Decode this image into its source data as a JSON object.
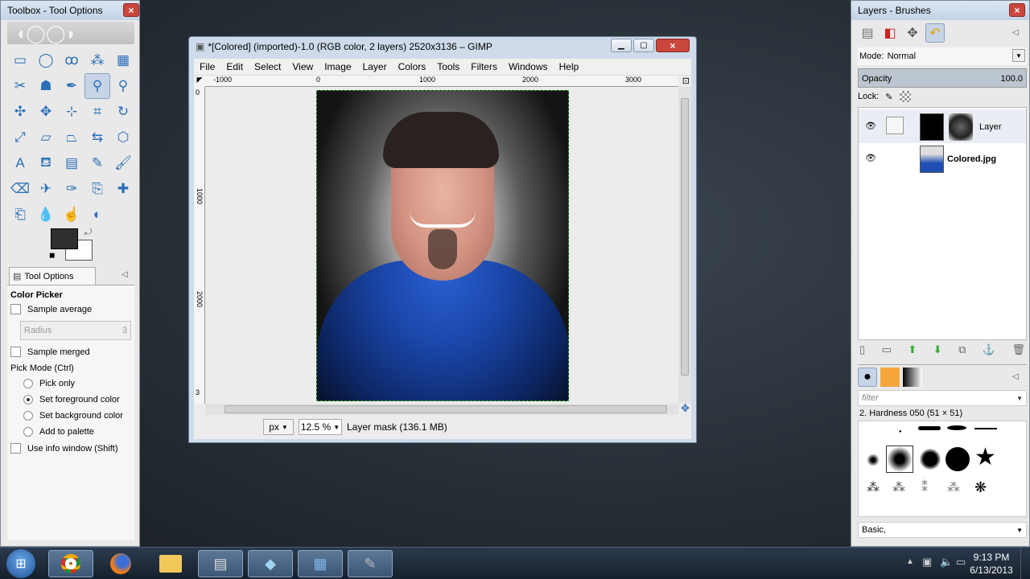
{
  "toolbox": {
    "title": "Toolbox - Tool Options",
    "close": "×",
    "tools": [
      {
        "icon": "rect-select-icon",
        "glyph": "▭"
      },
      {
        "icon": "ellipse-select-icon",
        "glyph": "◯"
      },
      {
        "icon": "lasso-icon",
        "glyph": "ꝏ"
      },
      {
        "icon": "fuzzy-select-icon",
        "glyph": "⁂"
      },
      {
        "icon": "color-select-icon",
        "glyph": "▦"
      },
      {
        "icon": "scissors-icon",
        "glyph": "✂"
      },
      {
        "icon": "foreground-select-icon",
        "glyph": "☗"
      },
      {
        "icon": "paths-icon",
        "glyph": "✒"
      },
      {
        "icon": "color-picker-icon",
        "glyph": "⚲"
      },
      {
        "icon": "zoom-icon",
        "glyph": "⚲"
      },
      {
        "icon": "measure-icon",
        "glyph": "✣"
      },
      {
        "icon": "move-icon",
        "glyph": "✥"
      },
      {
        "icon": "align-icon",
        "glyph": "⊹"
      },
      {
        "icon": "crop-icon",
        "glyph": "⌗"
      },
      {
        "icon": "rotate-icon",
        "glyph": "↻"
      },
      {
        "icon": "scale-icon",
        "glyph": "⤢"
      },
      {
        "icon": "shear-icon",
        "glyph": "▱"
      },
      {
        "icon": "perspective-icon",
        "glyph": "⏢"
      },
      {
        "icon": "flip-icon",
        "glyph": "⇆"
      },
      {
        "icon": "cage-icon",
        "glyph": "⬡"
      },
      {
        "icon": "text-icon",
        "glyph": "A"
      },
      {
        "icon": "bucket-fill-icon",
        "glyph": "⛾"
      },
      {
        "icon": "blend-icon",
        "glyph": "▤"
      },
      {
        "icon": "pencil-icon",
        "glyph": "✎"
      },
      {
        "icon": "paintbrush-icon",
        "glyph": "🖌"
      },
      {
        "icon": "eraser-icon",
        "glyph": "⌫"
      },
      {
        "icon": "airbrush-icon",
        "glyph": "✈"
      },
      {
        "icon": "ink-icon",
        "glyph": "✑"
      },
      {
        "icon": "clone-icon",
        "glyph": "⎘"
      },
      {
        "icon": "heal-icon",
        "glyph": "✚"
      },
      {
        "icon": "perspective-clone-icon",
        "glyph": "⎗"
      },
      {
        "icon": "blur-icon",
        "glyph": "💧"
      },
      {
        "icon": "smudge-icon",
        "glyph": "☝"
      },
      {
        "icon": "dodge-icon",
        "glyph": "◐"
      }
    ],
    "selected_tool": 8,
    "tool_options_tab": "Tool Options",
    "color_picker_heading": "Color Picker",
    "sample_average": "Sample average",
    "radius_label": "Radius",
    "radius_value": "3",
    "sample_merged": "Sample merged",
    "pick_mode": "Pick Mode  (Ctrl)",
    "options": [
      "Pick only",
      "Set foreground color",
      "Set background color",
      "Add to palette"
    ],
    "selected_option": 1,
    "use_info_window": "Use info window  (Shift)"
  },
  "gimp": {
    "title": "*[Colored] (imported)-1.0 (RGB color, 2 layers) 2520x3136 – GIMP",
    "menus": [
      "File",
      "Edit",
      "Select",
      "View",
      "Image",
      "Layer",
      "Colors",
      "Tools",
      "Filters",
      "Windows",
      "Help"
    ],
    "ruler_h": [
      "-1000",
      "0",
      "1000",
      "2000",
      "3000"
    ],
    "ruler_v": [
      "0",
      "1000",
      "2000",
      "3"
    ],
    "unit": "px",
    "zoom": "12.5 %",
    "status": "Layer mask (136.1 MB)"
  },
  "dock": {
    "title": "Layers - Brushes",
    "mode_label": "Mode:",
    "mode_value": "Normal",
    "opacity_label": "Opacity",
    "opacity_value": "100.0",
    "opacity_fraction": 1.0,
    "lock_label": "Lock:",
    "layers": [
      {
        "name": "Layer",
        "visible": true
      },
      {
        "name": "Colored.jpg",
        "visible": true
      }
    ],
    "filter_placeholder": "filter",
    "brush_name": "2. Hardness 050 (51 × 51)",
    "brush_tag": "Basic,"
  },
  "taskbar": {
    "time": "9:13 PM",
    "date": "6/13/2013"
  },
  "colors": {
    "accent": "#2b6fb7",
    "shirt": "#1f4fb4"
  }
}
